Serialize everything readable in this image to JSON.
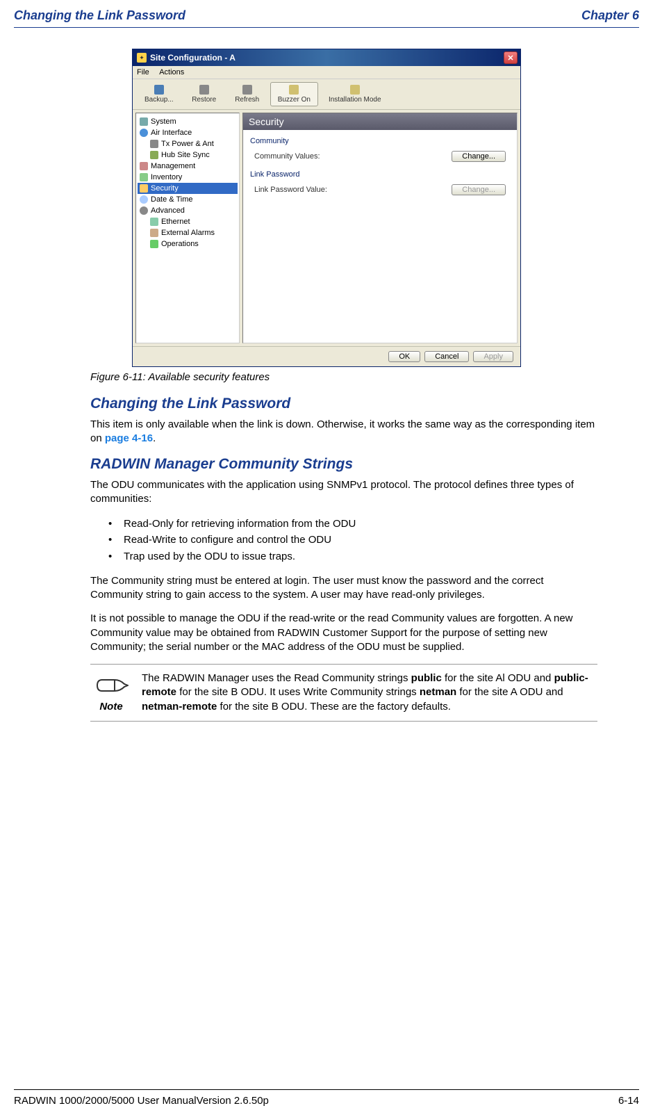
{
  "header": {
    "left": "Changing the Link Password",
    "right": "Chapter 6"
  },
  "dialog": {
    "title": "Site Configuration - A",
    "menus": [
      "File",
      "Actions"
    ],
    "toolbar": [
      "Backup...",
      "Restore",
      "Refresh",
      "Buzzer On",
      "Installation Mode"
    ],
    "tree": [
      {
        "label": "System"
      },
      {
        "label": "Air Interface"
      },
      {
        "label": "Tx Power & Ant",
        "indent": true
      },
      {
        "label": "Hub Site Sync",
        "indent": true
      },
      {
        "label": "Management"
      },
      {
        "label": "Inventory"
      },
      {
        "label": "Security",
        "selected": true
      },
      {
        "label": "Date & Time"
      },
      {
        "label": "Advanced"
      },
      {
        "label": "Ethernet",
        "indent": true
      },
      {
        "label": "External Alarms",
        "indent": true
      },
      {
        "label": "Operations",
        "indent": true
      }
    ],
    "panel": {
      "title": "Security",
      "community": {
        "group": "Community",
        "label": "Community Values:",
        "button": "Change..."
      },
      "linkpw": {
        "group": "Link Password",
        "label": "Link Password Value:",
        "button": "Change..."
      }
    },
    "buttons": {
      "ok": "OK",
      "cancel": "Cancel",
      "apply": "Apply"
    }
  },
  "caption": "Figure 6-11: Available security features",
  "sections": {
    "s1_title": "Changing the Link Password",
    "s1_body_a": "This item is only available when the link is down. Otherwise, it works the same way as the corresponding item on ",
    "s1_link": "page 4-16",
    "s1_body_b": ".",
    "s2_title": "RADWIN Manager Community Strings",
    "s2_body": "The ODU communicates with the application using SNMPv1 protocol. The protocol defines three types of communities:",
    "bullets": [
      "Read-Only for retrieving information from the ODU",
      "Read-Write to configure and control the ODU",
      "Trap used by the ODU to issue traps."
    ],
    "s2_p2": "The Community string must be entered at login. The user must know the password and the correct Community string to gain access to the system. A user may have read-only privileges.",
    "s2_p3": "It is not possible to manage the ODU if the read-write or the read Community values are forgotten. A new Community value may be obtained from RADWIN Customer Support for the purpose of setting new Community; the serial number or the MAC address of the ODU must be supplied."
  },
  "note": {
    "label": "Note",
    "pre": "The RADWIN Manager uses the Read Community strings ",
    "b1": "public",
    "t1": " for the site Al ODU and ",
    "b2": "public-remote",
    "t2": " for the site B ODU. It uses Write Community strings ",
    "b3": "netman",
    "t3": " for the site A ODU and ",
    "b4": "netman-remote",
    "t4": " for the site B ODU. These are the factory defaults."
  },
  "footer": {
    "left": "RADWIN 1000/2000/5000 User ManualVersion  2.6.50p",
    "right": "6-14"
  }
}
